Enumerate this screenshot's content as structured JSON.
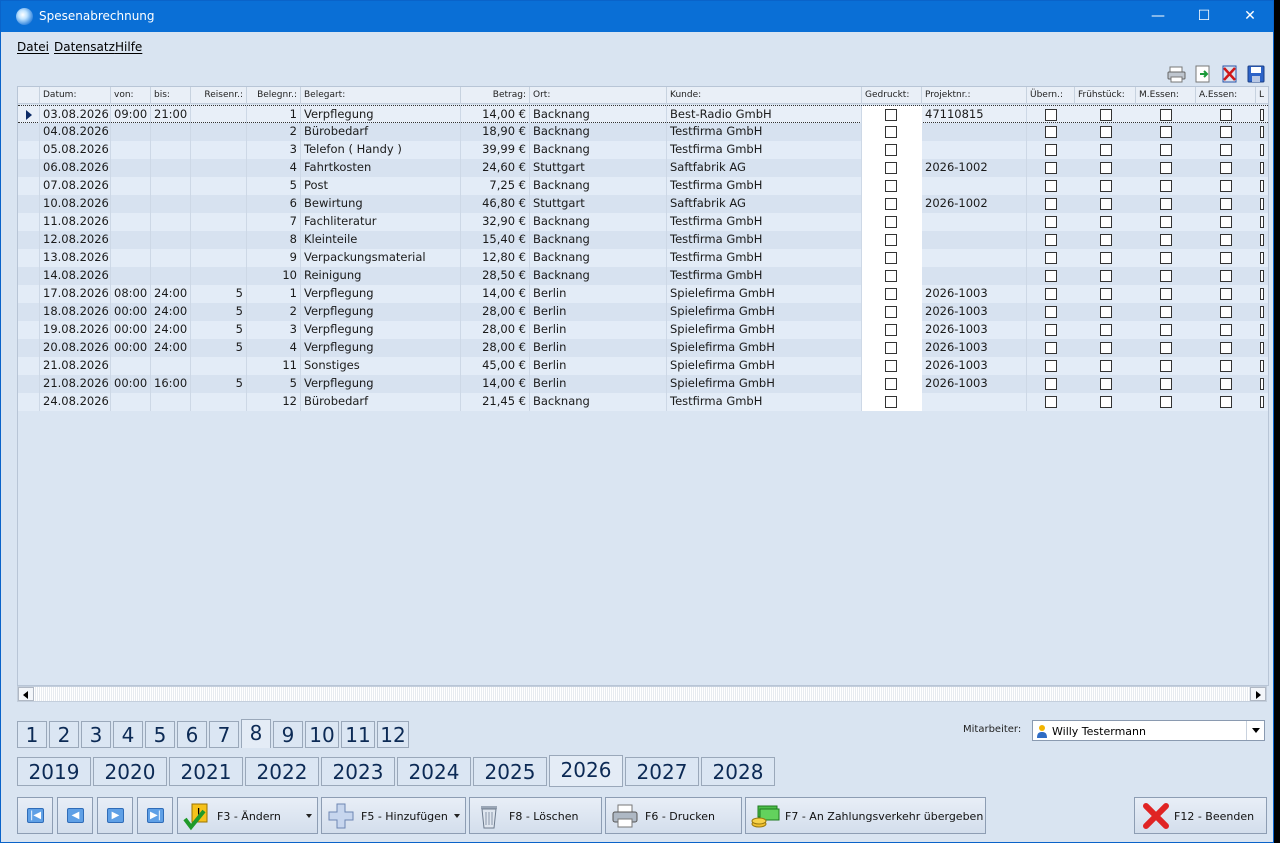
{
  "window": {
    "title": "Spesenabrechnung",
    "minimize": "—",
    "maximize": "☐",
    "close": "✕"
  },
  "menu": [
    "Datei",
    "Datensatz",
    "Hilfe"
  ],
  "toolbar": [
    "printer-icon",
    "export-icon",
    "delete-icon",
    "save-icon"
  ],
  "columns": [
    {
      "key": "datum",
      "label": "Datum:"
    },
    {
      "key": "von",
      "label": "von:"
    },
    {
      "key": "bis",
      "label": "bis:"
    },
    {
      "key": "reisenr",
      "label": "Reisenr.:"
    },
    {
      "key": "belegnr",
      "label": "Belegnr.:"
    },
    {
      "key": "belegart",
      "label": "Belegart:"
    },
    {
      "key": "betrag",
      "label": "Betrag:"
    },
    {
      "key": "ort",
      "label": "Ort:"
    },
    {
      "key": "kunde",
      "label": "Kunde:"
    },
    {
      "key": "gedruckt",
      "label": "Gedruckt:"
    },
    {
      "key": "projektnr",
      "label": "Projektnr.:"
    },
    {
      "key": "uebern",
      "label": "Übern.:"
    },
    {
      "key": "fruehstueck",
      "label": "Frühstück:"
    },
    {
      "key": "messen",
      "label": "M.Essen:"
    },
    {
      "key": "aessen",
      "label": "A.Essen:"
    },
    {
      "key": "l",
      "label": "L"
    }
  ],
  "rows": [
    {
      "datum": "03.08.2026",
      "von": "09:00",
      "bis": "21:00",
      "reisenr": "",
      "belegnr": "1",
      "belegart": "Verpflegung",
      "betrag": "14,00 €",
      "ort": "Backnang",
      "kunde": "Best-Radio GmbH",
      "projektnr": "47110815"
    },
    {
      "datum": "04.08.2026",
      "von": "",
      "bis": "",
      "reisenr": "",
      "belegnr": "2",
      "belegart": "Bürobedarf",
      "betrag": "18,90 €",
      "ort": "Backnang",
      "kunde": "Testfirma GmbH",
      "projektnr": ""
    },
    {
      "datum": "05.08.2026",
      "von": "",
      "bis": "",
      "reisenr": "",
      "belegnr": "3",
      "belegart": "Telefon ( Handy )",
      "betrag": "39,99 €",
      "ort": "Backnang",
      "kunde": "Testfirma GmbH",
      "projektnr": ""
    },
    {
      "datum": "06.08.2026",
      "von": "",
      "bis": "",
      "reisenr": "",
      "belegnr": "4",
      "belegart": "Fahrtkosten",
      "betrag": "24,60 €",
      "ort": "Stuttgart",
      "kunde": "Saftfabrik AG",
      "projektnr": "2026-1002"
    },
    {
      "datum": "07.08.2026",
      "von": "",
      "bis": "",
      "reisenr": "",
      "belegnr": "5",
      "belegart": "Post",
      "betrag": "7,25 €",
      "ort": "Backnang",
      "kunde": "Testfirma GmbH",
      "projektnr": ""
    },
    {
      "datum": "10.08.2026",
      "von": "",
      "bis": "",
      "reisenr": "",
      "belegnr": "6",
      "belegart": "Bewirtung",
      "betrag": "46,80 €",
      "ort": "Stuttgart",
      "kunde": "Saftfabrik AG",
      "projektnr": "2026-1002"
    },
    {
      "datum": "11.08.2026",
      "von": "",
      "bis": "",
      "reisenr": "",
      "belegnr": "7",
      "belegart": "Fachliteratur",
      "betrag": "32,90 €",
      "ort": "Backnang",
      "kunde": "Testfirma GmbH",
      "projektnr": ""
    },
    {
      "datum": "12.08.2026",
      "von": "",
      "bis": "",
      "reisenr": "",
      "belegnr": "8",
      "belegart": "Kleinteile",
      "betrag": "15,40 €",
      "ort": "Backnang",
      "kunde": "Testfirma GmbH",
      "projektnr": ""
    },
    {
      "datum": "13.08.2026",
      "von": "",
      "bis": "",
      "reisenr": "",
      "belegnr": "9",
      "belegart": "Verpackungsmaterial",
      "betrag": "12,80 €",
      "ort": "Backnang",
      "kunde": "Testfirma GmbH",
      "projektnr": ""
    },
    {
      "datum": "14.08.2026",
      "von": "",
      "bis": "",
      "reisenr": "",
      "belegnr": "10",
      "belegart": "Reinigung",
      "betrag": "28,50 €",
      "ort": "Backnang",
      "kunde": "Testfirma GmbH",
      "projektnr": ""
    },
    {
      "datum": "17.08.2026",
      "von": "08:00",
      "bis": "24:00",
      "reisenr": "5",
      "belegnr": "1",
      "belegart": "Verpflegung",
      "betrag": "14,00 €",
      "ort": "Berlin",
      "kunde": "Spielefirma GmbH",
      "projektnr": "2026-1003"
    },
    {
      "datum": "18.08.2026",
      "von": "00:00",
      "bis": "24:00",
      "reisenr": "5",
      "belegnr": "2",
      "belegart": "Verpflegung",
      "betrag": "28,00 €",
      "ort": "Berlin",
      "kunde": "Spielefirma GmbH",
      "projektnr": "2026-1003"
    },
    {
      "datum": "19.08.2026",
      "von": "00:00",
      "bis": "24:00",
      "reisenr": "5",
      "belegnr": "3",
      "belegart": "Verpflegung",
      "betrag": "28,00 €",
      "ort": "Berlin",
      "kunde": "Spielefirma GmbH",
      "projektnr": "2026-1003"
    },
    {
      "datum": "20.08.2026",
      "von": "00:00",
      "bis": "24:00",
      "reisenr": "5",
      "belegnr": "4",
      "belegart": "Verpflegung",
      "betrag": "28,00 €",
      "ort": "Berlin",
      "kunde": "Spielefirma GmbH",
      "projektnr": "2026-1003"
    },
    {
      "datum": "21.08.2026",
      "von": "",
      "bis": "",
      "reisenr": "",
      "belegnr": "11",
      "belegart": "Sonstiges",
      "betrag": "45,00 €",
      "ort": "Berlin",
      "kunde": "Spielefirma GmbH",
      "projektnr": "2026-1003"
    },
    {
      "datum": "21.08.2026",
      "von": "00:00",
      "bis": "16:00",
      "reisenr": "5",
      "belegnr": "5",
      "belegart": "Verpflegung",
      "betrag": "14,00 €",
      "ort": "Berlin",
      "kunde": "Spielefirma GmbH",
      "projektnr": "2026-1003"
    },
    {
      "datum": "24.08.2026",
      "von": "",
      "bis": "",
      "reisenr": "",
      "belegnr": "12",
      "belegart": "Bürobedarf",
      "betrag": "21,45 €",
      "ort": "Backnang",
      "kunde": "Testfirma GmbH",
      "projektnr": ""
    }
  ],
  "months": [
    "1",
    "2",
    "3",
    "4",
    "5",
    "6",
    "7",
    "8",
    "9",
    "10",
    "11",
    "12"
  ],
  "active_month": "8",
  "years": [
    "2019",
    "2020",
    "2021",
    "2022",
    "2023",
    "2024",
    "2025",
    "2026",
    "2027",
    "2028"
  ],
  "active_year": "2026",
  "mitarbeiter": {
    "label": "Mitarbeiter:",
    "value": "Willy Testermann"
  },
  "buttons": {
    "first": "|◀",
    "prev": "◀",
    "next": "▶",
    "last": "▶|",
    "aendern": "F3 - Ändern",
    "hinzufuegen": "F5 - Hinzufügen",
    "loeschen": "F8 - Löschen",
    "drucken": "F6 - Drucken",
    "zahlung": "F7 - An Zahlungsverkehr übergeben",
    "beenden": "F12 - Beenden"
  },
  "colors": {
    "titlebar": "#0a6fd6",
    "background": "#d9e4f1",
    "selected_arrow": "#0b2a66"
  }
}
